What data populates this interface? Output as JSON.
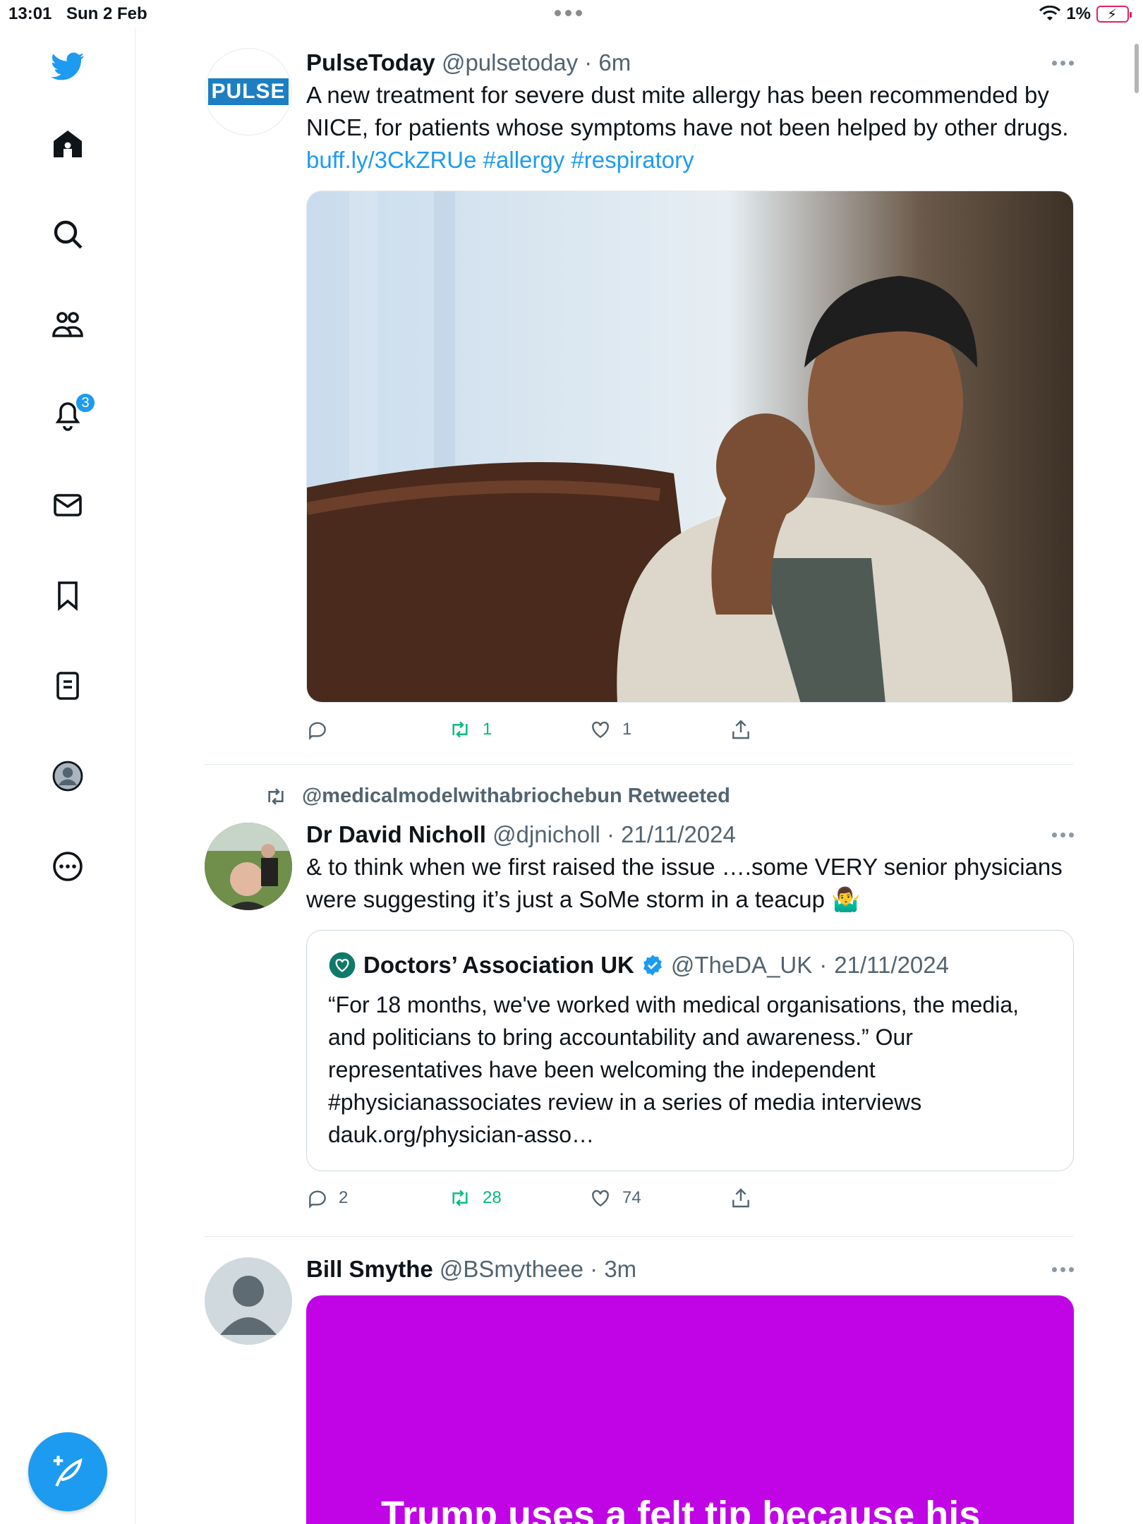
{
  "status_bar": {
    "time": "13:01",
    "date": "Sun 2 Feb",
    "battery": "1%"
  },
  "sidebar": {
    "items": [
      "twitter-logo",
      "home",
      "explore",
      "communities",
      "notifications",
      "messages",
      "bookmarks",
      "lists",
      "profile",
      "more"
    ],
    "notifications_badge": "3"
  },
  "tweets": [
    {
      "name": "PulseToday",
      "handle": "@pulsetoday",
      "time": "6m",
      "avatar_text": "PULSE",
      "text": "A new treatment for severe dust mite allergy has been recommended by NICE, for patients whose symptoms have not been helped by other drugs.",
      "link": "buff.ly/3CkZRUe",
      "hashtags": "#allergy #respiratory",
      "replies": "",
      "retweets": "1",
      "likes": "1"
    },
    {
      "retweeted_by": "@medicalmodelwithabriochebun Retweeted",
      "name": "Dr David Nicholl",
      "handle": "@djnicholl",
      "time": "21/11/2024",
      "text": "& to think when we first raised the issue ….some VERY senior physicians were suggesting it’s just a SoMe storm in a teacup 🤷‍♂️",
      "quote": {
        "name": "Doctors’ Association UK",
        "handle": "@TheDA_UK",
        "time": "21/11/2024",
        "text": "“For 18 months, we've worked with medical organisations, the media, and politicians to bring accountability and awareness.” Our representatives have been welcoming the independent #physicianassociates review in a series of media interviews dauk.org/physician-asso…"
      },
      "replies": "2",
      "retweets": "28",
      "likes": "74"
    },
    {
      "name": "Bill Smythe",
      "handle": "@BSmytheee",
      "time": "3m",
      "media_text": "Trump uses a felt tip because his"
    }
  ],
  "colors": {
    "accent": "#1d9bf0",
    "retweet": "#00ba7c",
    "purple_media": "#c004e6"
  }
}
